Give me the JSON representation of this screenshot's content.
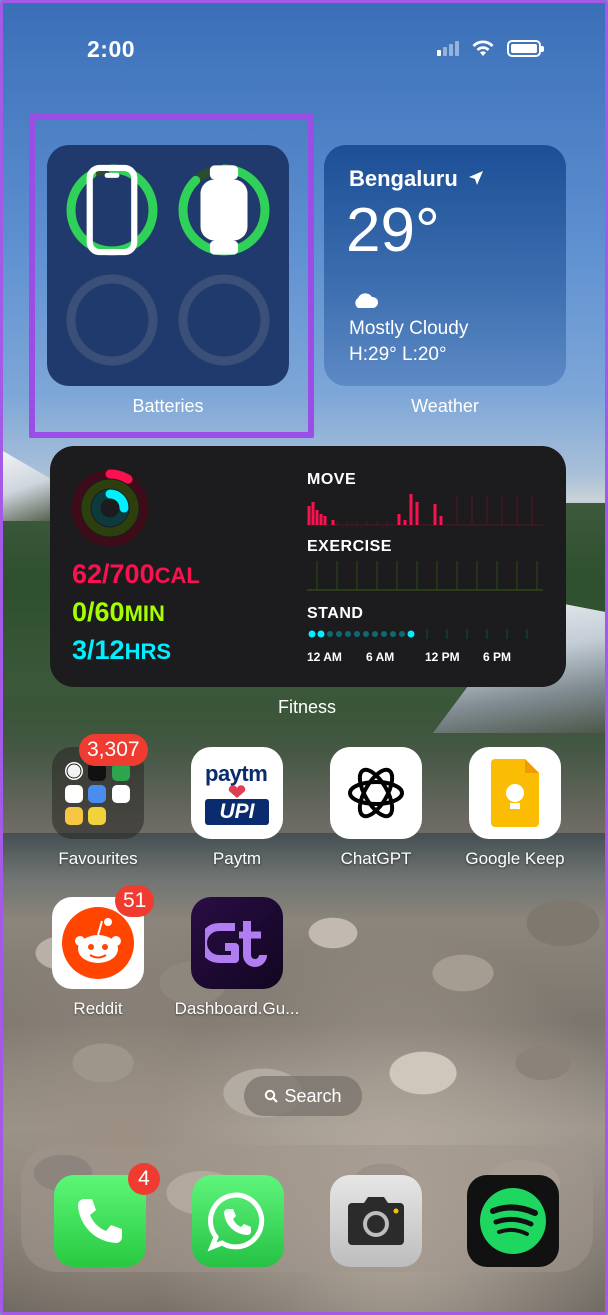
{
  "status_bar": {
    "time": "2:00"
  },
  "batteries_widget": {
    "label": "Batteries"
  },
  "weather_widget": {
    "city": "Bengaluru",
    "temperature": "29°",
    "condition": "Mostly Cloudy",
    "high_low": "H:29° L:20°",
    "label": "Weather"
  },
  "fitness_widget": {
    "move_value": "62/700",
    "move_unit": "CAL",
    "exercise_value": "0/60",
    "exercise_unit": "MIN",
    "stand_value": "3/12",
    "stand_unit": "HRS",
    "move_heading": "MOVE",
    "exercise_heading": "EXERCISE",
    "stand_heading": "STAND",
    "time_labels": [
      "12 AM",
      "6 AM",
      "12 PM",
      "6 PM"
    ],
    "label": "Fitness"
  },
  "apps": {
    "favourites": {
      "label": "Favourites",
      "badge": "3,307"
    },
    "paytm": {
      "label": "Paytm",
      "logo_top": "paytm",
      "logo_bottom": "UPI"
    },
    "chatgpt": {
      "label": "ChatGPT"
    },
    "google_keep": {
      "label": "Google Keep"
    },
    "reddit": {
      "label": "Reddit",
      "badge": "51"
    },
    "dashboard": {
      "label": "Dashboard.Gu..."
    }
  },
  "search": {
    "label": "Search"
  },
  "dock": {
    "phone_badge": "4"
  },
  "colors": {
    "move": "#fa114f",
    "exercise": "#a6ff00",
    "stand": "#00f0ff",
    "battery_green": "#30d158",
    "highlight": "#9b4ee6",
    "badge_red": "#ef3b30"
  }
}
